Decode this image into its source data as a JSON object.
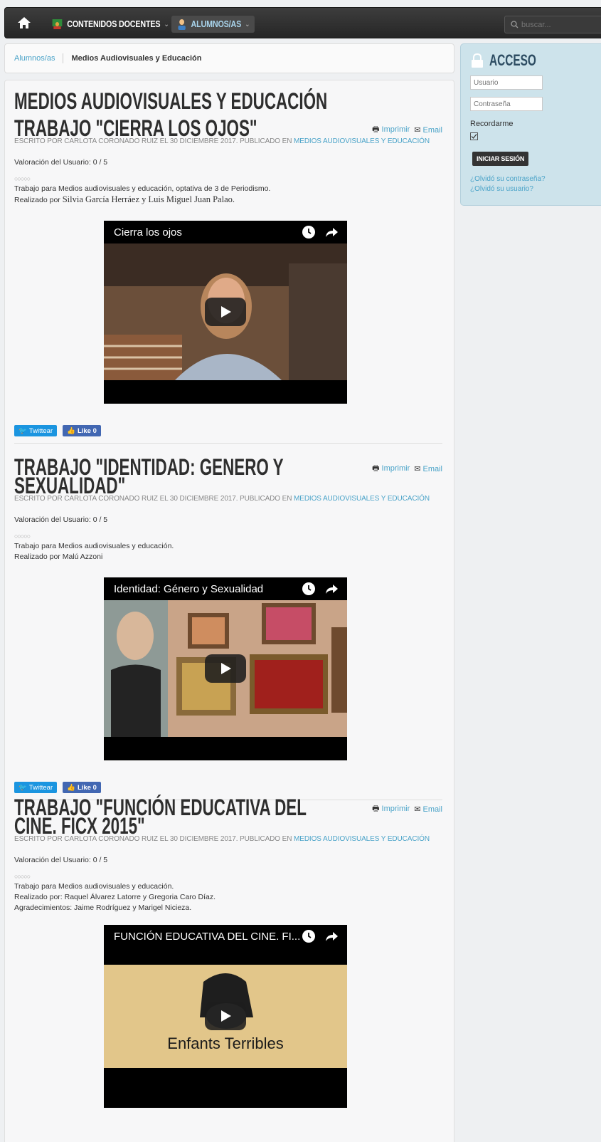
{
  "nav": {
    "contenidos_label": "CONTENIDOS DOCENTES",
    "alumnos_label": "ALUMNOS/AS",
    "search_placeholder": "buscar..."
  },
  "breadcrumb": {
    "parent": "Alumnos/as",
    "current": "Medios Audiovisuales y Educación"
  },
  "page": {
    "title": "MEDIOS AUDIOVISUALES Y EDUCACIÓN"
  },
  "tools": {
    "print": "Imprimir",
    "email": "Email"
  },
  "articles": [
    {
      "title": "TRABAJO \"CIERRA LOS OJOS\"",
      "meta_prefix": "ESCRITO POR CARLOTA CORONADO RUIZ EL 30 DICIEMBRE 2017. PUBLICADO EN ",
      "category": "MEDIOS AUDIOVISUALES Y EDUCACIÓN",
      "rating": "Valoración del Usuario: 0 / 5",
      "stars": "○○○○○",
      "line1": "Trabajo para Medios audiovisuales y educación, optativa de 3 de Periodismo.",
      "line2_prefix": "Realizado por ",
      "line2_names": "Silvia García Herráez y Luis Miguel Juan Palao.",
      "video_title": "Cierra los ojos"
    },
    {
      "title": "TRABAJO \"IDENTIDAD: GENERO Y SEXUALIDAD\"",
      "meta_prefix": "ESCRITO POR CARLOTA CORONADO RUIZ EL 30 DICIEMBRE 2017. PUBLICADO EN ",
      "category": "MEDIOS AUDIOVISUALES Y EDUCACIÓN",
      "rating": "Valoración del Usuario: 0 / 5",
      "stars": "○○○○○",
      "line1": "Trabajo para Medios audiovisuales y educación.",
      "line2": "Realizado por Malú Azzoni",
      "video_title": "Identidad: Género y Sexualidad"
    },
    {
      "title": "TRABAJO \"FUNCIÓN EDUCATIVA DEL CINE. FICX 2015\"",
      "meta_prefix": "ESCRITO POR CARLOTA CORONADO RUIZ EL 30 DICIEMBRE 2017. PUBLICADO EN ",
      "category": "MEDIOS AUDIOVISUALES Y EDUCACIÓN",
      "rating": "Valoración del Usuario: 0 / 5",
      "stars": "○○○○○",
      "line1": "Trabajo para Medios audiovisuales y educación.",
      "line2": "Realizado por: Raquel Álvarez Latorre y Gregoria Caro Díaz.",
      "line3": "Agradecimientos: Jaime Rodríguez y Marigel Nicieza.",
      "video_title": "FUNCIÓN EDUCATIVA DEL CINE. FI...",
      "video_caption": "Enfants Terribles"
    }
  ],
  "social": {
    "twitter": "Twittear",
    "like": "Like 0"
  },
  "sidebar": {
    "title": "ACCESO",
    "user_placeholder": "Usuario",
    "pass_placeholder": "Contraseña",
    "remember": "Recordarme",
    "login_button": "INICIAR SESIÓN",
    "forgot_password": "¿Olvidó su contraseña?",
    "forgot_user": "¿Olvidó su usuario?"
  }
}
